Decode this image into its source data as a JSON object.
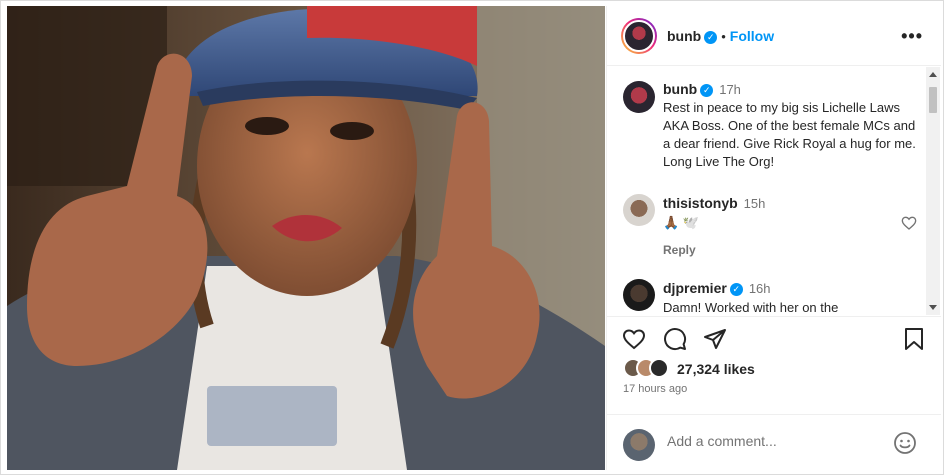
{
  "post": {
    "author": "bunb",
    "follow_label": "Follow",
    "more_icon": "more-horizontal-icon",
    "caption": {
      "author": "bunb",
      "time": "17h",
      "text": "Rest in peace to my big sis Lichelle Laws AKA Boss. One of the best female MCs and a dear friend. Give Rick Royal a hug for me. Long Live The Org!"
    }
  },
  "comments": [
    {
      "author": "thisistonyb",
      "time": "15h",
      "text": "🙏🏾 🕊️",
      "reply_label": "Reply"
    },
    {
      "author": "djpremier",
      "time": "16h",
      "text": "Damn! Worked with her on the"
    }
  ],
  "actions": {
    "like_icon": "heart-icon",
    "comment_icon": "comment-icon",
    "share_icon": "send-icon",
    "save_icon": "bookmark-icon"
  },
  "likes": {
    "count_label": "27,324 likes"
  },
  "timestamp": "17 hours ago",
  "add_comment": {
    "placeholder": "Add a comment...",
    "emoji_icon": "smiley-icon"
  },
  "colors": {
    "accent": "#0095f6",
    "text": "#262626",
    "muted": "#737373"
  }
}
